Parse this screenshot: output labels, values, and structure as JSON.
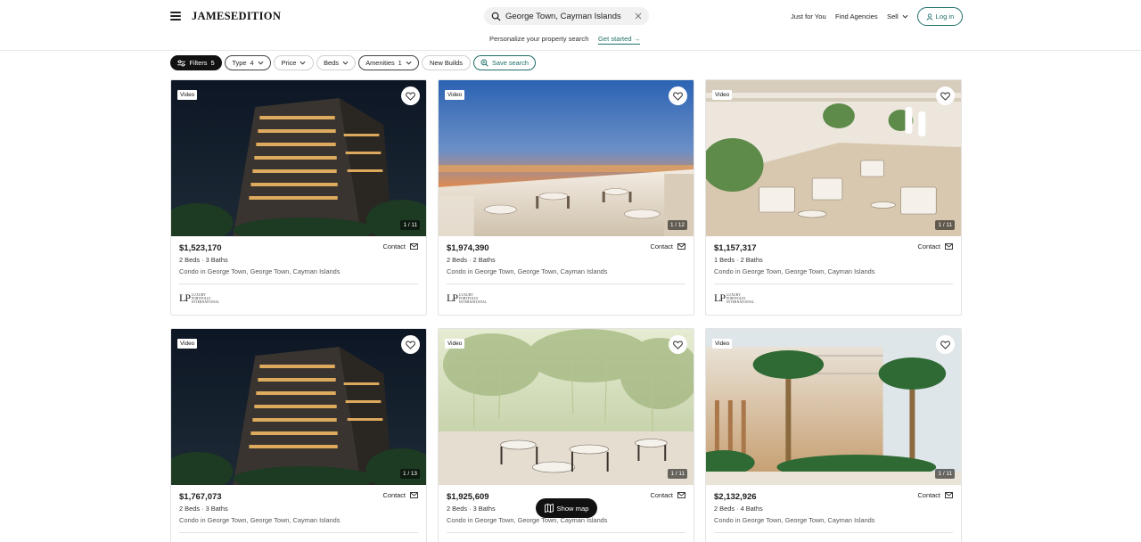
{
  "header": {
    "logo": "JAMESEDITION",
    "search_value": "George Town, Cayman Islands",
    "nav_just_for_you": "Just for You",
    "nav_find_agencies": "Find Agencies",
    "nav_sell": "Sell",
    "login": "Log in"
  },
  "promo": {
    "text": "Personalize your property search",
    "link": "Get started"
  },
  "filters": {
    "filters_label": "Filters",
    "filters_count": "5",
    "type_label": "Type",
    "type_count": "4",
    "price_label": "Price",
    "beds_label": "Beds",
    "amenities_label": "Amenities",
    "amenities_count": "1",
    "new_builds": "New Builds",
    "save_search": "Save search"
  },
  "common": {
    "video": "Video",
    "contact": "Contact",
    "agency_line1": "LUXURY",
    "agency_line2": "PORTFOLIO",
    "agency_line3": "INTERNATIONAL",
    "agency_mark": "LP"
  },
  "listings": [
    {
      "price": "$1,523,170",
      "specs": "2 Beds · 3 Baths",
      "location": "Condo in George Town, George Town, Cayman Islands",
      "counter": "1 / 11"
    },
    {
      "price": "$1,974,390",
      "specs": "2 Beds · 2 Baths",
      "location": "Condo in George Town, George Town, Cayman Islands",
      "counter": "1 / 12"
    },
    {
      "price": "$1,157,317",
      "specs": "1 Beds · 2 Baths",
      "location": "Condo in George Town, George Town, Cayman Islands",
      "counter": "1 / 11"
    },
    {
      "price": "$1,767,073",
      "specs": "2 Beds · 3 Baths",
      "location": "Condo in George Town, George Town, Cayman Islands",
      "counter": "1 / 13"
    },
    {
      "price": "$1,925,609",
      "specs": "2 Beds · 3 Baths",
      "location": "Condo in George Town, George Town, Cayman Islands",
      "counter": "1 / 11"
    },
    {
      "price": "$2,132,926",
      "specs": "2 Beds · 4 Baths",
      "location": "Condo in George Town, George Town, Cayman Islands",
      "counter": "1 / 11"
    }
  ],
  "show_map": "Show map",
  "colors": {
    "accent": "#1f6f6a",
    "dark": "#111111"
  },
  "icons": [
    "menu-icon",
    "search-icon",
    "clear-icon",
    "chevron-down-icon",
    "user-icon",
    "sliders-icon",
    "save-search-icon",
    "heart-icon",
    "mail-icon",
    "map-icon"
  ]
}
